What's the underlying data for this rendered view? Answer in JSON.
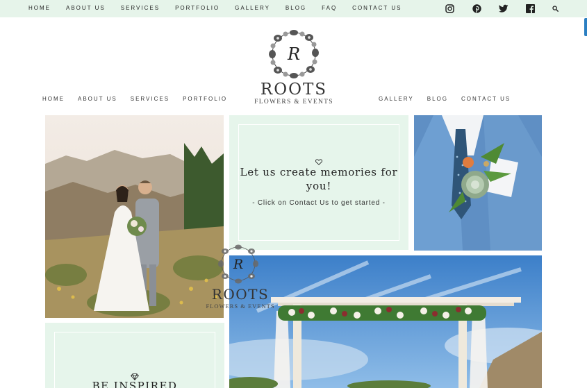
{
  "top_nav": {
    "items": [
      "HOME",
      "ABOUT US",
      "SERVICES",
      "PORTFOLIO",
      "GALLERY",
      "BLOG",
      "FAQ",
      "CONTACT US"
    ]
  },
  "social": {
    "icons": [
      "instagram-icon",
      "pinterest-icon",
      "twitter-icon",
      "facebook-icon",
      "search-icon"
    ]
  },
  "logo": {
    "monogram": "R",
    "word": "ROOTS",
    "tagline": "FLOWERS & EVENTS"
  },
  "main_nav": {
    "left": [
      "HOME",
      "ABOUT US",
      "SERVICES",
      "PORTFOLIO"
    ],
    "right": [
      "GALLERY",
      "BLOG",
      "CONTACT US"
    ]
  },
  "promo": {
    "icon": "heart-icon",
    "headline_line1": "Let us create memories for",
    "headline_line2": "you!",
    "subline": "- Click on Contact Us to get started -"
  },
  "inspire": {
    "icon": "diamond-icon",
    "headline": "BE INSPIRED"
  },
  "overlay_logo": {
    "monogram": "R",
    "word": "ROOTS",
    "tagline": "FLOWERS & EVENTS"
  },
  "colors": {
    "mint": "#e6f5eb",
    "topbar": "#e6f4ea",
    "accent_tab": "#2b7fc2"
  }
}
